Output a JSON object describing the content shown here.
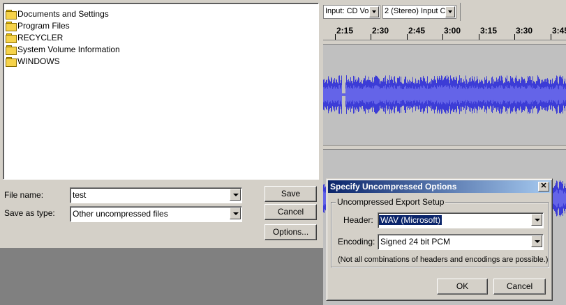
{
  "save_dialog": {
    "folders": [
      {
        "name": "Documents and Settings"
      },
      {
        "name": "Program Files"
      },
      {
        "name": "RECYCLER"
      },
      {
        "name": "System Volume Information"
      },
      {
        "name": "WINDOWS"
      }
    ],
    "file_name_label": "File name:",
    "file_name_value": "test",
    "save_type_label": "Save as type:",
    "save_type_value": "Other uncompressed files",
    "save_button": "Save",
    "cancel_button": "Cancel",
    "options_button": "Options..."
  },
  "toolbar": {
    "input_source": "Input: CD Vo",
    "input_channels": "2 (Stereo) Input C"
  },
  "ruler": {
    "labels": [
      "2:15",
      "2:30",
      "2:45",
      "3:00",
      "3:15",
      "3:30",
      "3:45"
    ]
  },
  "options_dialog": {
    "title": "Specify Uncompressed Options",
    "close_glyph": "✕",
    "group_title": "Uncompressed Export Setup",
    "header_label": "Header:",
    "header_value": "WAV (Microsoft)",
    "encoding_label": "Encoding:",
    "encoding_value": "Signed 24 bit PCM",
    "note": "(Not all combinations of headers and encodings are possible.)",
    "ok_button": "OK",
    "cancel_button": "Cancel"
  },
  "colors": {
    "waveform": "#3c3cd6",
    "waveform_rms": "#6464e8",
    "titlebar_start": "#0a246a",
    "titlebar_end": "#a6caf0"
  }
}
